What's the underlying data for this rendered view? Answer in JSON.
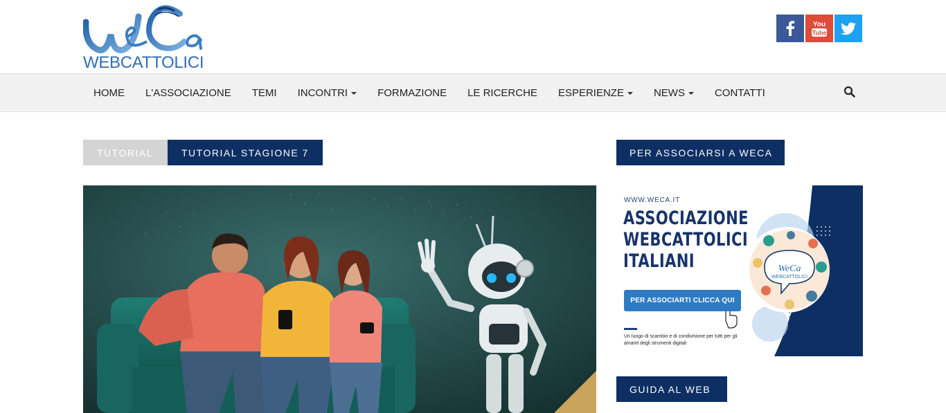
{
  "header": {
    "logo_wordmark": "WEBCATTOLICI",
    "logo_script": "WeCa",
    "social": [
      {
        "name": "facebook",
        "label": "f",
        "color": "#3b5998"
      },
      {
        "name": "youtube",
        "label": "You Tube",
        "color": "#dd4b39"
      },
      {
        "name": "twitter",
        "label": "twitter",
        "color": "#1da1f2"
      }
    ]
  },
  "nav": {
    "items": [
      {
        "label": "HOME",
        "dropdown": false
      },
      {
        "label": "L'ASSOCIAZIONE",
        "dropdown": false
      },
      {
        "label": "TEMI",
        "dropdown": false
      },
      {
        "label": "INCONTRI",
        "dropdown": true
      },
      {
        "label": "FORMAZIONE",
        "dropdown": false
      },
      {
        "label": "LE RICERCHE",
        "dropdown": false
      },
      {
        "label": "ESPERIENZE",
        "dropdown": true
      },
      {
        "label": "NEWS",
        "dropdown": true
      },
      {
        "label": "CONTATTI",
        "dropdown": false
      }
    ],
    "search_icon": "search-icon"
  },
  "breadcrumb": {
    "category": "TUTORIAL",
    "subcategory": "TUTORIAL STAGIONE 7"
  },
  "sidebar": {
    "associate_title": "PER ASSOCIARSI A WECA",
    "banner": {
      "url": "WWW.WECA.IT",
      "headline": [
        "ASSOCIAZIONE",
        "WEBCATTOLICI",
        "ITALIANI"
      ],
      "cta": "PER ASSOCIARTI CLICCA QUI",
      "tagline": "Un luogo di scambio e di condivisione per tutti per gli amanti degli strumenti digitali",
      "badge_script": "WeCa",
      "badge_wordmark": "WEBCATTOLICI"
    },
    "guide_title": "GUIDA AL WEB"
  },
  "colors": {
    "navy": "#0d2f63",
    "nav_bg": "#f1f1f1",
    "grey_crumb": "#d4d4d4",
    "logo_blue": "#2f6fb5"
  }
}
